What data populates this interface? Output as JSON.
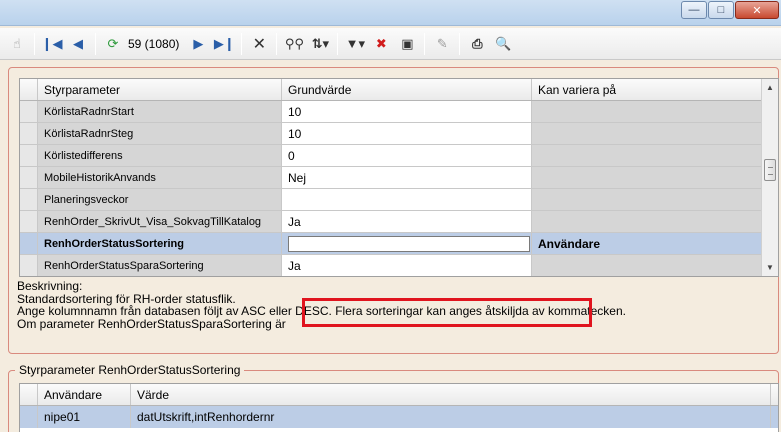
{
  "window": {
    "minimize_icon": "minimize-icon",
    "maximize_icon": "maximize-icon",
    "close_icon": "close-icon"
  },
  "toolbar": {
    "record_position": "59 (1080)",
    "icons": [
      "hand-icon",
      "first-record-icon",
      "previous-record-icon",
      "refresh-icon",
      "next-record-icon",
      "last-record-icon",
      "delete-icon",
      "find-icon",
      "sort-icon",
      "filter-icon",
      "clear-filter-icon",
      "view-icon",
      "edit-icon",
      "print-icon",
      "print-preview-icon"
    ]
  },
  "params_grid": {
    "columns": [
      "Styrparameter",
      "Grundvärde",
      "Kan variera på"
    ],
    "rows": [
      {
        "name": "KörlistaRadnrStart",
        "value": "10",
        "vary": ""
      },
      {
        "name": "KörlistaRadnrSteg",
        "value": "10",
        "vary": ""
      },
      {
        "name": "Körlistedifferens",
        "value": "0",
        "vary": ""
      },
      {
        "name": "MobileHistorikAnvands",
        "value": "Nej",
        "vary": ""
      },
      {
        "name": "Planeringsveckor",
        "value": "",
        "vary": ""
      },
      {
        "name": "RenhOrder_SkrivUt_Visa_SokvagTillKatalog",
        "value": "Ja",
        "vary": ""
      },
      {
        "name": "RenhOrderStatusSortering",
        "value": "",
        "vary": "Användare"
      },
      {
        "name": "RenhOrderStatusSparaSortering",
        "value": "Ja",
        "vary": ""
      }
    ]
  },
  "description": {
    "label": "Beskrivning:",
    "line1": "Standardsortering för RH-order statusflik.",
    "line2a": "Ange kolumnnamn från databasen följt av ASC eller DESC.",
    "line2b": "Flera sorteringar kan anges åtskiljda av kommatecken.",
    "line3": "Om parameter RenhOrderStatusSparaSortering är"
  },
  "detail": {
    "legend": "Styrparameter RenhOrderStatusSortering",
    "columns": [
      "Användare",
      "Värde"
    ],
    "rows": [
      {
        "user": "nipe01",
        "value": "datUtskrift,intRenhordernr"
      }
    ]
  },
  "colors": {
    "highlight": "#e0141e",
    "selection": "#bccde6",
    "panel_border": "#d98a7e"
  }
}
